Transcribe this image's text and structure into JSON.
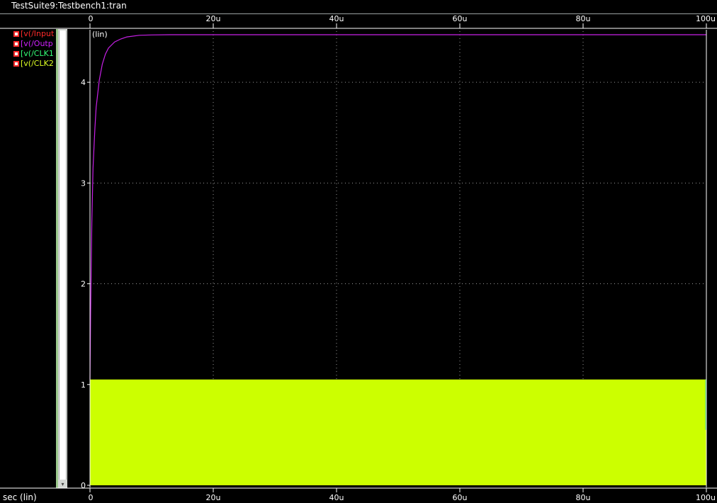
{
  "window": {
    "title": "TestSuite9:Testbench1:tran"
  },
  "legend": [
    {
      "label": "[v(/Input",
      "color": "#ff2a2a"
    },
    {
      "label": "[v(/Outp",
      "color": "#d020ff"
    },
    {
      "label": "[v(/CLK1",
      "color": "#33ff77"
    },
    {
      "label": "[v(/CLK2",
      "color": "#ddff22"
    }
  ],
  "colors": {
    "background": "#000000",
    "grid": "#9a9a9a",
    "clk2_fill": "#ccff00",
    "output": "#c820e8",
    "clk1": "#33cc77"
  },
  "chart_data": {
    "type": "line",
    "title": "",
    "xlabel": "sec (lin)",
    "ylabel": "(lin)",
    "xlim": [
      0,
      100
    ],
    "ylim": [
      0,
      4.5
    ],
    "grid": true,
    "x_ticks": [
      "0",
      "20u",
      "40u",
      "60u",
      "80u",
      "100u"
    ],
    "x_tick_values": [
      0,
      20,
      40,
      60,
      80,
      100
    ],
    "y_ticks": [
      "0",
      "1",
      "2",
      "3",
      "4"
    ],
    "y_tick_values": [
      0,
      1,
      2,
      3,
      4
    ],
    "series": [
      {
        "name": "[v(/Input",
        "color": "#ff2a2a",
        "x": [
          0,
          100
        ],
        "y": [
          1.05,
          1.05
        ]
      },
      {
        "name": "[v(/Outp",
        "color": "#c820e8",
        "x": [
          0,
          0.1,
          0.3,
          0.5,
          0.8,
          1,
          1.5,
          2,
          2.5,
          3,
          4,
          5,
          6,
          8,
          10,
          13,
          20,
          40,
          60,
          80,
          100
        ],
        "y": [
          1.05,
          1.7,
          2.6,
          3.15,
          3.55,
          3.75,
          4.02,
          4.18,
          4.28,
          4.34,
          4.4,
          4.43,
          4.45,
          4.466,
          4.47,
          4.472,
          4.472,
          4.472,
          4.472,
          4.472,
          4.472
        ]
      },
      {
        "name": "[v(/CLK1",
        "color": "#33cc77",
        "x": [
          0,
          100
        ],
        "y": [
          0,
          1.05
        ]
      },
      {
        "name": "[v(/CLK2",
        "color": "#ccff00",
        "x": [
          0,
          100
        ],
        "y": [
          1.05,
          1.05
        ],
        "filled": true
      }
    ]
  }
}
